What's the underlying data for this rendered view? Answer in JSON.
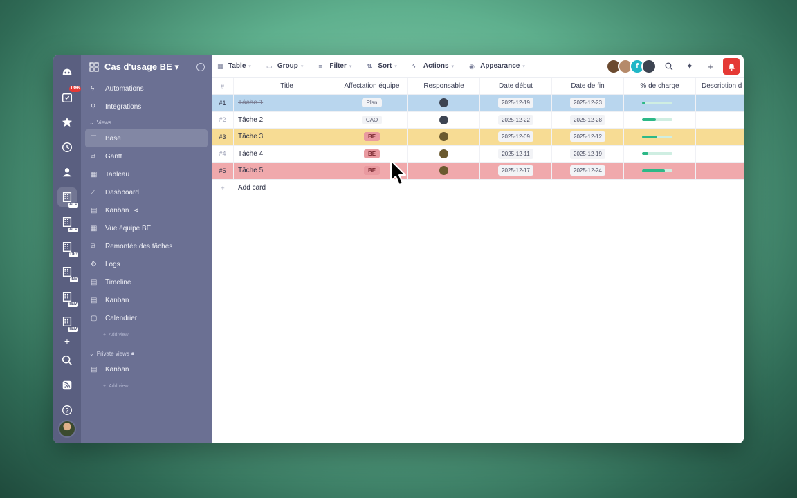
{
  "sidebar": {
    "project_title": "Cas d'usage BE",
    "top_items": [
      {
        "label": "Automations"
      },
      {
        "label": "Integrations"
      }
    ],
    "views_header": "Views",
    "views": [
      {
        "label": "Base"
      },
      {
        "label": "Gantt"
      },
      {
        "label": "Tableau"
      },
      {
        "label": "Dashboard"
      },
      {
        "label": "Kanban"
      },
      {
        "label": "Vue équipe BE"
      },
      {
        "label": "Remontée des tâches"
      },
      {
        "label": "Logs"
      },
      {
        "label": "Timeline"
      },
      {
        "label": "Kanban"
      },
      {
        "label": "Calendrier"
      }
    ],
    "add_view": "Add view",
    "private_header": "Private views",
    "private_views": [
      {
        "label": "Kanban"
      }
    ],
    "add_view_private": "Add view"
  },
  "rail": {
    "badge": "1366",
    "tags": [
      "ALP",
      "ALP",
      "DIG",
      "INV",
      "TEM",
      "TEM"
    ]
  },
  "toolbar": {
    "table": "Table",
    "group": "Group",
    "filter": "Filter",
    "sort": "Sort",
    "actions": "Actions",
    "appearance": "Appearance",
    "avatar_letter": "f"
  },
  "table": {
    "headers": {
      "num": "#",
      "title": "Title",
      "aff": "Affectation équipe",
      "resp": "Responsable",
      "deb": "Date début",
      "fin": "Date de fin",
      "chg": "% de charge",
      "desc": "Description d"
    },
    "rows": [
      {
        "num": "#1",
        "title": "Tâche 1",
        "aff": "Plan",
        "deb": "2025-12-19",
        "fin": "2025-12-23",
        "charge": 0.12
      },
      {
        "num": "#2",
        "title": "Tâche 2",
        "aff": "CAO",
        "deb": "2025-12-22",
        "fin": "2025-12-28",
        "charge": 0.45
      },
      {
        "num": "#3",
        "title": "Tâche 3",
        "aff": "BE",
        "deb": "2025-12-09",
        "fin": "2025-12-12",
        "charge": 0.5
      },
      {
        "num": "#4",
        "title": "Tâche 4",
        "aff": "BE",
        "deb": "2025-12-11",
        "fin": "2025-12-19",
        "charge": 0.2
      },
      {
        "num": "#5",
        "title": "Tâche 5",
        "aff": "BE",
        "deb": "2025-12-17",
        "fin": "2025-12-24",
        "charge": 0.75
      }
    ],
    "add_card": "Add card"
  }
}
